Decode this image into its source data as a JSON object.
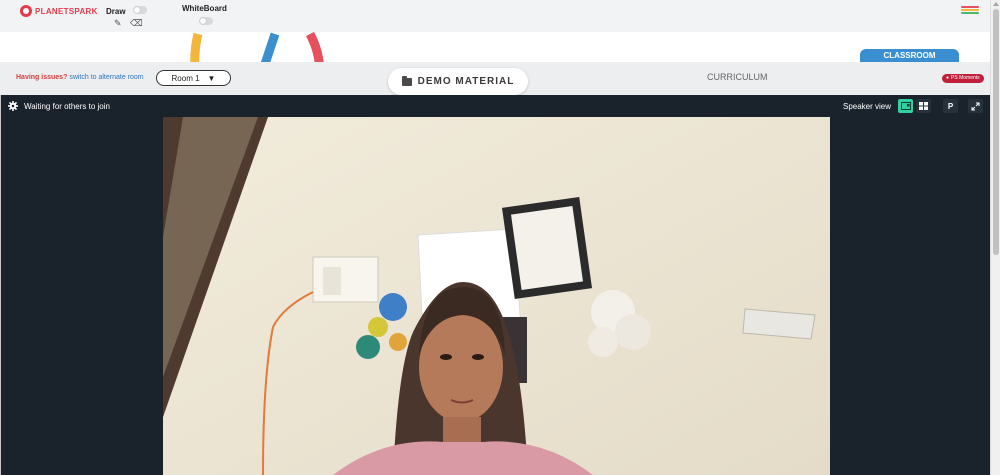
{
  "app": {
    "logo_text": "PLANETSPARK"
  },
  "toolbar": {
    "draw_label": "Draw",
    "whiteboard_label": "WhiteBoard",
    "pencil_icon": "pencil-icon",
    "eraser_icon": "eraser-icon",
    "menu_icon": "hamburger-menu-icon",
    "menu_colors": [
      "#e6505c",
      "#f4b63a",
      "#4bb86f",
      "#3a8fd0",
      "#8a5bc7"
    ]
  },
  "classroom_tab": {
    "label": "CLASSROOM"
  },
  "controls": {
    "issue_prefix": "Having issues?",
    "issue_link": "switch to alternate room",
    "room_select": {
      "value": "Room 1",
      "arrow": "▼"
    },
    "demo_material_label": "DEMO MATERIAL",
    "curriculum_label": "CURRICULUM",
    "ps_moments_label": "PS Moments"
  },
  "video": {
    "status_text": "Waiting for others to join",
    "speaker_view_label": "Speaker view",
    "p_button_label": "P",
    "accent_color": "#2fd1a3",
    "background_color": "#1a222b"
  }
}
